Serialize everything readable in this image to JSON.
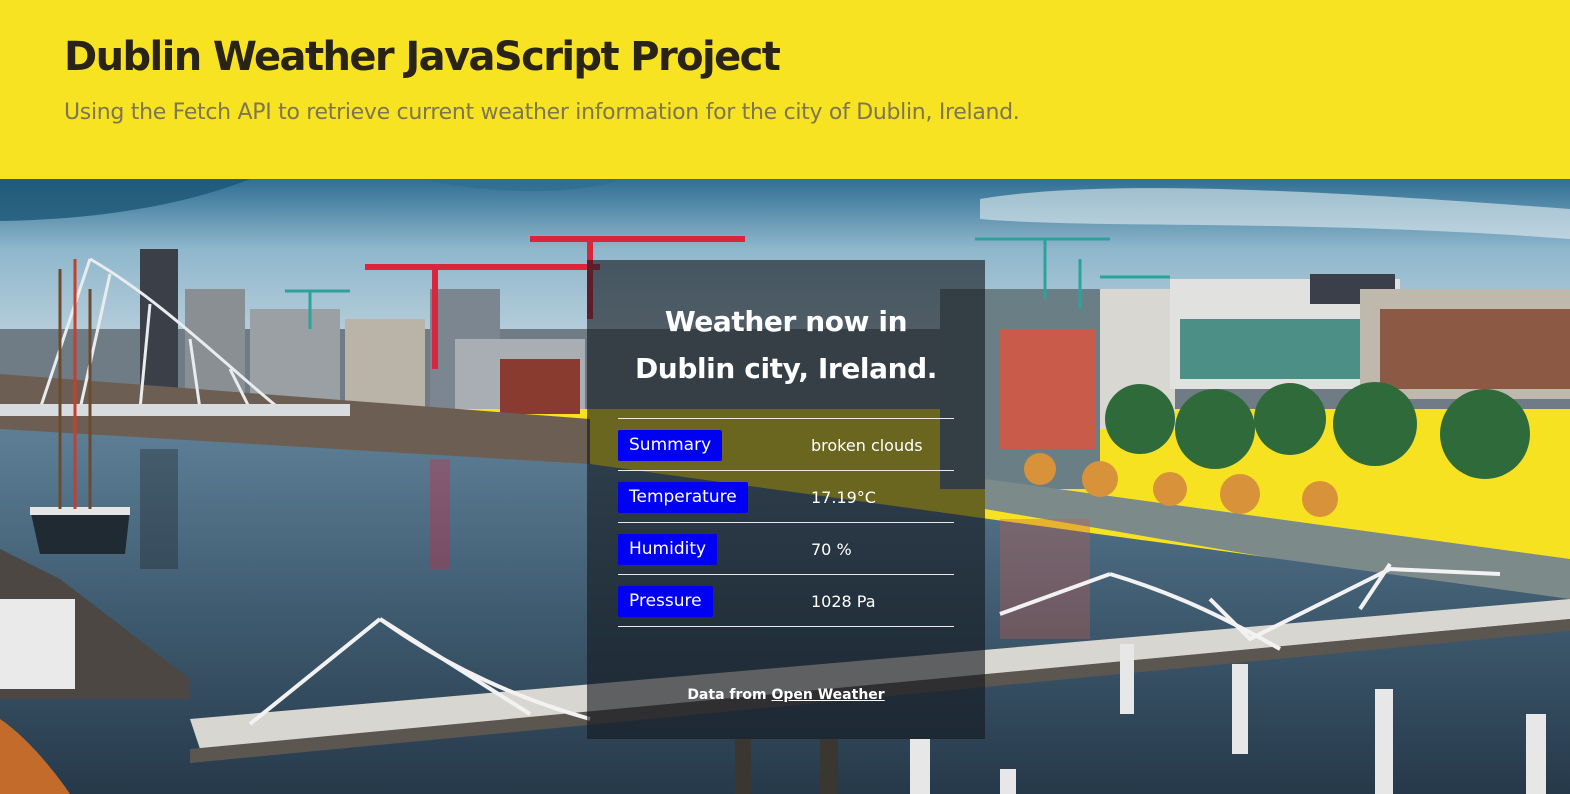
{
  "header": {
    "title": "Dublin Weather JavaScript Project",
    "subtitle": "Using the Fetch API to retrieve current weather information for the city of Dublin, Ireland."
  },
  "card": {
    "heading_line1": "Weather now in",
    "heading_line2": "Dublin city, Ireland.",
    "rows": [
      {
        "label": "Summary",
        "value": "broken clouds"
      },
      {
        "label": "Temperature",
        "value": "17.19°C"
      },
      {
        "label": "Humidity",
        "value": "70 %"
      },
      {
        "label": "Pressure",
        "value": "1028 Pa"
      }
    ],
    "credit_prefix": "Data from",
    "credit_link": "Open Weather"
  },
  "colors": {
    "header_bg": "#f7e321",
    "label_bg": "#0000f2",
    "card_bg": "rgba(20,24,30,0.62)"
  }
}
